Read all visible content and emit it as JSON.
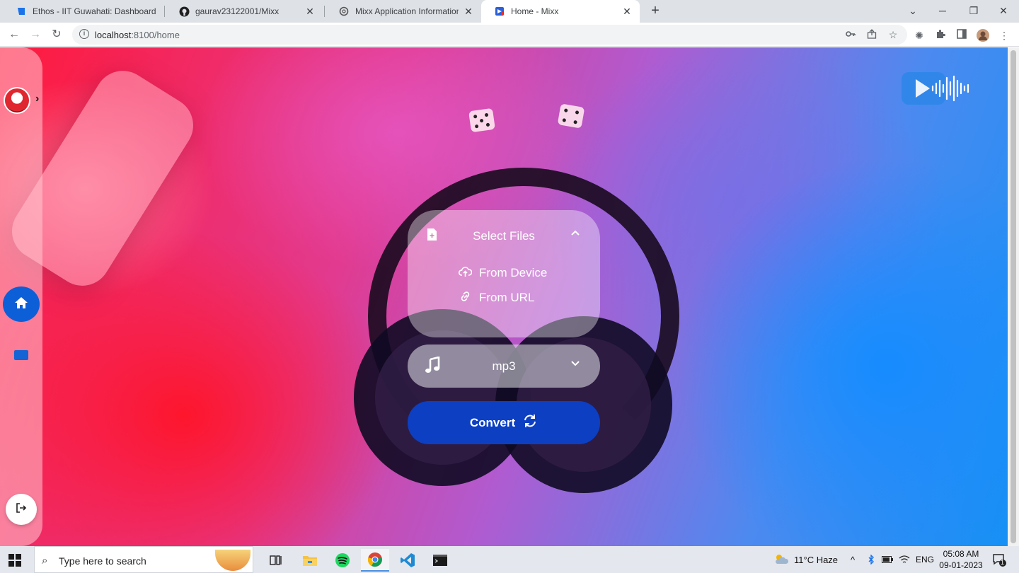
{
  "browser": {
    "tabs": [
      {
        "title": "Ethos - IIT Guwahati: Dashboard",
        "favicon": "ethos-icon",
        "active": false
      },
      {
        "title": "gaurav23122001/Mixx",
        "favicon": "github-icon",
        "active": false
      },
      {
        "title": "Mixx Application Information",
        "favicon": "openai-icon",
        "active": false
      },
      {
        "title": "Home - Mixx",
        "favicon": "mixx-icon",
        "active": true
      }
    ],
    "new_tab_symbol": "+",
    "close_symbol": "✕",
    "url_host": "localhost",
    "url_path": ":8100/home"
  },
  "sidebar": {
    "expand_symbol": "›",
    "items": [
      {
        "name": "home",
        "icon": "home-icon",
        "active": true
      },
      {
        "name": "playlist",
        "icon": "folder-icon",
        "active": false
      }
    ],
    "logout_icon": "logout-icon"
  },
  "main": {
    "select_files_label": "Select Files",
    "options": [
      {
        "label": "From Device",
        "icon": "cloud-upload-icon"
      },
      {
        "label": "From URL",
        "icon": "link-icon"
      }
    ],
    "format_value": "mp3",
    "convert_label": "Convert"
  },
  "taskbar": {
    "search_placeholder": "Type here to search",
    "weather": "11°C  Haze",
    "language": "ENG",
    "time": "05:08 AM",
    "date": "09-01-2023",
    "notification_count": "1"
  },
  "colors": {
    "accent": "#0d3fc2",
    "home_button": "#0d5fd8"
  }
}
